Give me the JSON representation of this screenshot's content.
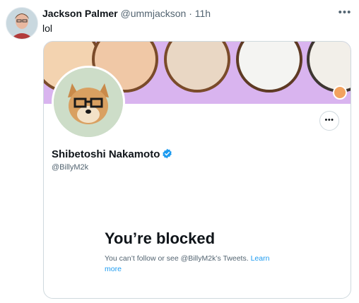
{
  "tweet": {
    "author_name": "Jackson Palmer",
    "author_handle": "@ummjackson",
    "separator": " · ",
    "time": "11h",
    "text": "lol",
    "more_icon": "more-horizontal-icon"
  },
  "card": {
    "display_name": "Shibetoshi Nakamoto",
    "verified_icon": "verified-badge-icon",
    "handle": "@BillyM2k",
    "more_icon": "more-horizontal-icon",
    "blocked_title": "You’re blocked",
    "blocked_text": "You can’t follow or see @BillyM2k’s Tweets. ",
    "learn_more": "Learn more"
  },
  "colors": {
    "link": "#1d9bf0",
    "banner": "#d9b4ef",
    "verified": "#1d9bf0",
    "secondary_text": "#536471"
  }
}
